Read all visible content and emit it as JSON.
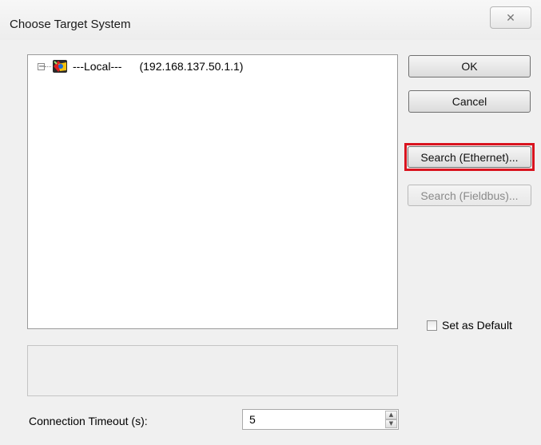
{
  "window": {
    "title": "Choose Target System",
    "close_glyph": "✕"
  },
  "tree": {
    "nodes": [
      {
        "expander": "−",
        "label": "---Local---",
        "address": "(192.168.137.50.1.1)",
        "icon": "target-system-icon"
      }
    ]
  },
  "buttons": {
    "ok": "OK",
    "cancel": "Cancel",
    "search_ethernet": "Search (Ethernet)...",
    "search_fieldbus": "Search (Fieldbus)..."
  },
  "set_default": {
    "label": "Set as Default",
    "checked": false
  },
  "timeout": {
    "label": "Connection Timeout (s):",
    "value": "5",
    "up_glyph": "▲",
    "down_glyph": "▼"
  },
  "colors": {
    "highlight": "#d9141f"
  }
}
